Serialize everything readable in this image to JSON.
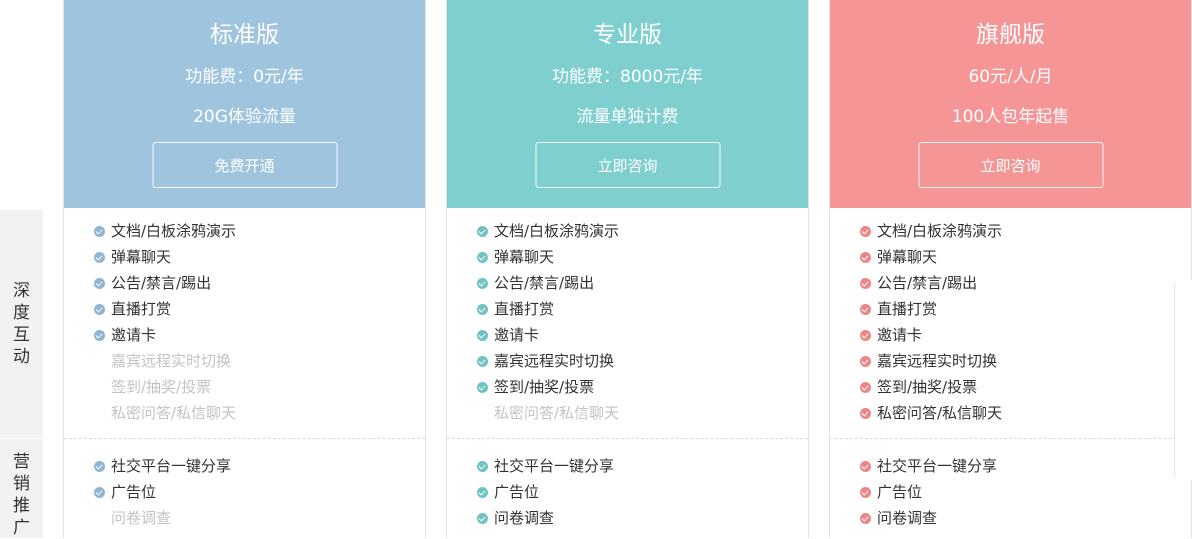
{
  "categories": {
    "interaction": [
      "深",
      "度",
      "互",
      "动"
    ],
    "marketing": [
      "营",
      "销",
      "推",
      "广"
    ]
  },
  "colors": {
    "standard": "#9fc4de",
    "pro": "#7fcfcf",
    "flagship": "#f59595",
    "check_standard": "#8fb5d3",
    "check_pro": "#6fc3c3",
    "check_flagship": "#ec8686",
    "disabled_text": "#c3c3c3"
  },
  "plans": [
    {
      "name": "标准版",
      "price": "功能费：0元/年",
      "note": "20G体验流量",
      "button": "免费开通",
      "interaction": [
        {
          "label": "文档/白板涂鸦演示",
          "enabled": true
        },
        {
          "label": "弹幕聊天",
          "enabled": true
        },
        {
          "label": "公告/禁言/踢出",
          "enabled": true
        },
        {
          "label": "直播打赏",
          "enabled": true
        },
        {
          "label": "邀请卡",
          "enabled": true
        },
        {
          "label": "嘉宾远程实时切换",
          "enabled": false
        },
        {
          "label": "签到/抽奖/投票",
          "enabled": false
        },
        {
          "label": "私密问答/私信聊天",
          "enabled": false
        }
      ],
      "marketing": [
        {
          "label": "社交平台一键分享",
          "enabled": true
        },
        {
          "label": "广告位",
          "enabled": true
        },
        {
          "label": "问卷调查",
          "enabled": false
        }
      ]
    },
    {
      "name": "专业版",
      "price": "功能费：8000元/年",
      "note": "流量单独计费",
      "button": "立即咨询",
      "interaction": [
        {
          "label": "文档/白板涂鸦演示",
          "enabled": true
        },
        {
          "label": "弹幕聊天",
          "enabled": true
        },
        {
          "label": "公告/禁言/踢出",
          "enabled": true
        },
        {
          "label": "直播打赏",
          "enabled": true
        },
        {
          "label": "邀请卡",
          "enabled": true
        },
        {
          "label": "嘉宾远程实时切换",
          "enabled": true
        },
        {
          "label": "签到/抽奖/投票",
          "enabled": true
        },
        {
          "label": "私密问答/私信聊天",
          "enabled": false
        }
      ],
      "marketing": [
        {
          "label": "社交平台一键分享",
          "enabled": true
        },
        {
          "label": "广告位",
          "enabled": true
        },
        {
          "label": "问卷调查",
          "enabled": true
        }
      ]
    },
    {
      "name": "旗舰版",
      "price": "60元/人/月",
      "note": "100人包年起售",
      "button": "立即咨询",
      "interaction": [
        {
          "label": "文档/白板涂鸦演示",
          "enabled": true
        },
        {
          "label": "弹幕聊天",
          "enabled": true
        },
        {
          "label": "公告/禁言/踢出",
          "enabled": true
        },
        {
          "label": "直播打赏",
          "enabled": true
        },
        {
          "label": "邀请卡",
          "enabled": true
        },
        {
          "label": "嘉宾远程实时切换",
          "enabled": true
        },
        {
          "label": "签到/抽奖/投票",
          "enabled": true
        },
        {
          "label": "私密问答/私信聊天",
          "enabled": true
        }
      ],
      "marketing": [
        {
          "label": "社交平台一键分享",
          "enabled": true
        },
        {
          "label": "广告位",
          "enabled": true
        },
        {
          "label": "问卷调查",
          "enabled": true
        }
      ]
    }
  ]
}
